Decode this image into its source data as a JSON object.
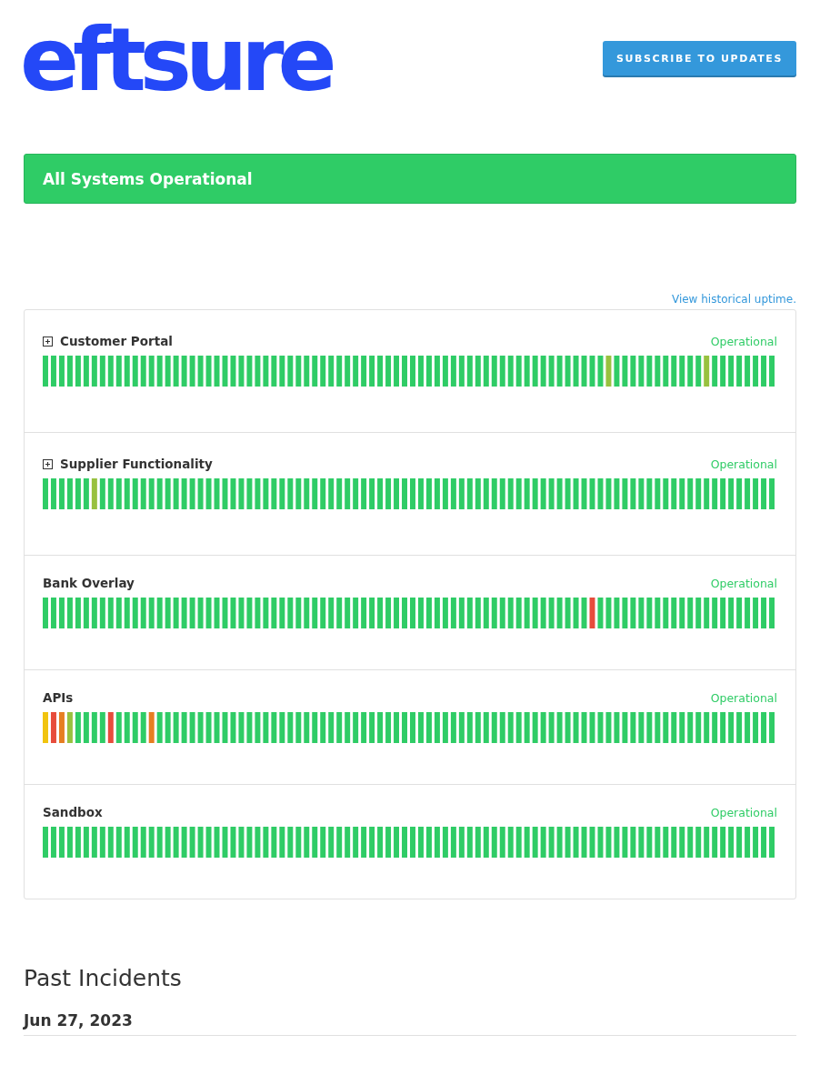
{
  "header": {
    "logo": "eftsure",
    "subscribe_button": "SUBSCRIBE TO UPDATES"
  },
  "status_banner": {
    "text": "All Systems Operational"
  },
  "uptime_link": "View historical uptime.",
  "components": [
    {
      "name": "Customer Portal",
      "expandable": true,
      "status": "Operational",
      "bars": [
        {
          "color": "#2fcc66"
        },
        {
          "color": "#2fcc66"
        },
        {
          "color": "#2fcc66"
        },
        {
          "color": "#2fcc66"
        },
        {
          "color": "#2fcc66"
        },
        {
          "color": "#2fcc66"
        },
        {
          "color": "#2fcc66"
        },
        {
          "color": "#2fcc66"
        },
        {
          "color": "#2fcc66"
        },
        {
          "color": "#2fcc66"
        },
        {
          "color": "#2fcc66"
        },
        {
          "color": "#2fcc66"
        },
        {
          "color": "#2fcc66"
        },
        {
          "color": "#2fcc66"
        },
        {
          "color": "#2fcc66"
        },
        {
          "color": "#2fcc66"
        },
        {
          "color": "#2fcc66"
        },
        {
          "color": "#2fcc66"
        },
        {
          "color": "#2fcc66"
        },
        {
          "color": "#2fcc66"
        },
        {
          "color": "#2fcc66"
        },
        {
          "color": "#2fcc66"
        },
        {
          "color": "#2fcc66"
        },
        {
          "color": "#2fcc66"
        },
        {
          "color": "#2fcc66"
        },
        {
          "color": "#2fcc66"
        },
        {
          "color": "#2fcc66"
        },
        {
          "color": "#2fcc66"
        },
        {
          "color": "#2fcc66"
        },
        {
          "color": "#2fcc66"
        },
        {
          "color": "#2fcc66"
        },
        {
          "color": "#2fcc66"
        },
        {
          "color": "#2fcc66"
        },
        {
          "color": "#2fcc66"
        },
        {
          "color": "#2fcc66"
        },
        {
          "color": "#2fcc66"
        },
        {
          "color": "#2fcc66"
        },
        {
          "color": "#2fcc66"
        },
        {
          "color": "#2fcc66"
        },
        {
          "color": "#2fcc66"
        },
        {
          "color": "#2fcc66"
        },
        {
          "color": "#2fcc66"
        },
        {
          "color": "#2fcc66"
        },
        {
          "color": "#2fcc66"
        },
        {
          "color": "#2fcc66"
        },
        {
          "color": "#2fcc66"
        },
        {
          "color": "#2fcc66"
        },
        {
          "color": "#2fcc66"
        },
        {
          "color": "#2fcc66"
        },
        {
          "color": "#2fcc66"
        },
        {
          "color": "#2fcc66"
        },
        {
          "color": "#2fcc66"
        },
        {
          "color": "#2fcc66"
        },
        {
          "color": "#2fcc66"
        },
        {
          "color": "#2fcc66"
        },
        {
          "color": "#2fcc66"
        },
        {
          "color": "#2fcc66"
        },
        {
          "color": "#2fcc66"
        },
        {
          "color": "#2fcc66"
        },
        {
          "color": "#2fcc66"
        },
        {
          "color": "#2fcc66"
        },
        {
          "color": "#2fcc66"
        },
        {
          "color": "#2fcc66"
        },
        {
          "color": "#2fcc66"
        },
        {
          "color": "#2fcc66"
        },
        {
          "color": "#2fcc66"
        },
        {
          "color": "#2fcc66"
        },
        {
          "color": "#2fcc66"
        },
        {
          "color": "#2fcc66"
        },
        {
          "color": "#98c13f"
        },
        {
          "color": "#2fcc66"
        },
        {
          "color": "#2fcc66"
        },
        {
          "color": "#2fcc66"
        },
        {
          "color": "#2fcc66"
        },
        {
          "color": "#2fcc66"
        },
        {
          "color": "#2fcc66"
        },
        {
          "color": "#2fcc66"
        },
        {
          "color": "#2fcc66"
        },
        {
          "color": "#2fcc66"
        },
        {
          "color": "#2fcc66"
        },
        {
          "color": "#2fcc66"
        },
        {
          "color": "#98c13f"
        },
        {
          "color": "#2fcc66"
        },
        {
          "color": "#2fcc66"
        },
        {
          "color": "#2fcc66"
        },
        {
          "color": "#2fcc66"
        },
        {
          "color": "#2fcc66"
        },
        {
          "color": "#2fcc66"
        },
        {
          "color": "#2fcc66"
        },
        {
          "color": "#2fcc66"
        }
      ]
    },
    {
      "name": "Supplier Functionality",
      "expandable": true,
      "status": "Operational",
      "bars": [
        {
          "color": "#2fcc66"
        },
        {
          "color": "#2fcc66"
        },
        {
          "color": "#2fcc66"
        },
        {
          "color": "#2fcc66"
        },
        {
          "color": "#2fcc66"
        },
        {
          "color": "#2fcc66"
        },
        {
          "color": "#98c13f"
        },
        {
          "color": "#2fcc66"
        },
        {
          "color": "#2fcc66"
        },
        {
          "color": "#2fcc66"
        },
        {
          "color": "#2fcc66"
        },
        {
          "color": "#2fcc66"
        },
        {
          "color": "#2fcc66"
        },
        {
          "color": "#2fcc66"
        },
        {
          "color": "#2fcc66"
        },
        {
          "color": "#2fcc66"
        },
        {
          "color": "#2fcc66"
        },
        {
          "color": "#2fcc66"
        },
        {
          "color": "#2fcc66"
        },
        {
          "color": "#2fcc66"
        },
        {
          "color": "#2fcc66"
        },
        {
          "color": "#2fcc66"
        },
        {
          "color": "#2fcc66"
        },
        {
          "color": "#2fcc66"
        },
        {
          "color": "#2fcc66"
        },
        {
          "color": "#2fcc66"
        },
        {
          "color": "#2fcc66"
        },
        {
          "color": "#2fcc66"
        },
        {
          "color": "#2fcc66"
        },
        {
          "color": "#2fcc66"
        },
        {
          "color": "#2fcc66"
        },
        {
          "color": "#2fcc66"
        },
        {
          "color": "#2fcc66"
        },
        {
          "color": "#2fcc66"
        },
        {
          "color": "#2fcc66"
        },
        {
          "color": "#2fcc66"
        },
        {
          "color": "#2fcc66"
        },
        {
          "color": "#2fcc66"
        },
        {
          "color": "#2fcc66"
        },
        {
          "color": "#2fcc66"
        },
        {
          "color": "#2fcc66"
        },
        {
          "color": "#2fcc66"
        },
        {
          "color": "#2fcc66"
        },
        {
          "color": "#2fcc66"
        },
        {
          "color": "#2fcc66"
        },
        {
          "color": "#2fcc66"
        },
        {
          "color": "#2fcc66"
        },
        {
          "color": "#2fcc66"
        },
        {
          "color": "#2fcc66"
        },
        {
          "color": "#2fcc66"
        },
        {
          "color": "#2fcc66"
        },
        {
          "color": "#2fcc66"
        },
        {
          "color": "#2fcc66"
        },
        {
          "color": "#2fcc66"
        },
        {
          "color": "#2fcc66"
        },
        {
          "color": "#2fcc66"
        },
        {
          "color": "#2fcc66"
        },
        {
          "color": "#2fcc66"
        },
        {
          "color": "#2fcc66"
        },
        {
          "color": "#2fcc66"
        },
        {
          "color": "#2fcc66"
        },
        {
          "color": "#2fcc66"
        },
        {
          "color": "#2fcc66"
        },
        {
          "color": "#2fcc66"
        },
        {
          "color": "#2fcc66"
        },
        {
          "color": "#2fcc66"
        },
        {
          "color": "#2fcc66"
        },
        {
          "color": "#2fcc66"
        },
        {
          "color": "#2fcc66"
        },
        {
          "color": "#2fcc66"
        },
        {
          "color": "#2fcc66"
        },
        {
          "color": "#2fcc66"
        },
        {
          "color": "#2fcc66"
        },
        {
          "color": "#2fcc66"
        },
        {
          "color": "#2fcc66"
        },
        {
          "color": "#2fcc66"
        },
        {
          "color": "#2fcc66"
        },
        {
          "color": "#2fcc66"
        },
        {
          "color": "#2fcc66"
        },
        {
          "color": "#2fcc66"
        },
        {
          "color": "#2fcc66"
        },
        {
          "color": "#2fcc66"
        },
        {
          "color": "#2fcc66"
        },
        {
          "color": "#2fcc66"
        },
        {
          "color": "#2fcc66"
        },
        {
          "color": "#2fcc66"
        },
        {
          "color": "#2fcc66"
        },
        {
          "color": "#2fcc66"
        },
        {
          "color": "#2fcc66"
        },
        {
          "color": "#2fcc66"
        }
      ]
    },
    {
      "name": "Bank Overlay",
      "expandable": false,
      "status": "Operational",
      "bars": [
        {
          "color": "#2fcc66"
        },
        {
          "color": "#2fcc66"
        },
        {
          "color": "#2fcc66"
        },
        {
          "color": "#2fcc66"
        },
        {
          "color": "#2fcc66"
        },
        {
          "color": "#2fcc66"
        },
        {
          "color": "#2fcc66"
        },
        {
          "color": "#2fcc66"
        },
        {
          "color": "#2fcc66"
        },
        {
          "color": "#2fcc66"
        },
        {
          "color": "#2fcc66"
        },
        {
          "color": "#2fcc66"
        },
        {
          "color": "#2fcc66"
        },
        {
          "color": "#2fcc66"
        },
        {
          "color": "#2fcc66"
        },
        {
          "color": "#2fcc66"
        },
        {
          "color": "#2fcc66"
        },
        {
          "color": "#2fcc66"
        },
        {
          "color": "#2fcc66"
        },
        {
          "color": "#2fcc66"
        },
        {
          "color": "#2fcc66"
        },
        {
          "color": "#2fcc66"
        },
        {
          "color": "#2fcc66"
        },
        {
          "color": "#2fcc66"
        },
        {
          "color": "#2fcc66"
        },
        {
          "color": "#2fcc66"
        },
        {
          "color": "#2fcc66"
        },
        {
          "color": "#2fcc66"
        },
        {
          "color": "#2fcc66"
        },
        {
          "color": "#2fcc66"
        },
        {
          "color": "#2fcc66"
        },
        {
          "color": "#2fcc66"
        },
        {
          "color": "#2fcc66"
        },
        {
          "color": "#2fcc66"
        },
        {
          "color": "#2fcc66"
        },
        {
          "color": "#2fcc66"
        },
        {
          "color": "#2fcc66"
        },
        {
          "color": "#2fcc66"
        },
        {
          "color": "#2fcc66"
        },
        {
          "color": "#2fcc66"
        },
        {
          "color": "#2fcc66"
        },
        {
          "color": "#2fcc66"
        },
        {
          "color": "#2fcc66"
        },
        {
          "color": "#2fcc66"
        },
        {
          "color": "#2fcc66"
        },
        {
          "color": "#2fcc66"
        },
        {
          "color": "#2fcc66"
        },
        {
          "color": "#2fcc66"
        },
        {
          "color": "#2fcc66"
        },
        {
          "color": "#2fcc66"
        },
        {
          "color": "#2fcc66"
        },
        {
          "color": "#2fcc66"
        },
        {
          "color": "#2fcc66"
        },
        {
          "color": "#2fcc66"
        },
        {
          "color": "#2fcc66"
        },
        {
          "color": "#2fcc66"
        },
        {
          "color": "#2fcc66"
        },
        {
          "color": "#2fcc66"
        },
        {
          "color": "#2fcc66"
        },
        {
          "color": "#2fcc66"
        },
        {
          "color": "#2fcc66"
        },
        {
          "color": "#2fcc66"
        },
        {
          "color": "#2fcc66"
        },
        {
          "color": "#2fcc66"
        },
        {
          "color": "#2fcc66"
        },
        {
          "color": "#2fcc66"
        },
        {
          "color": "#2fcc66"
        },
        {
          "color": "#e74c3c"
        },
        {
          "color": "#2fcc66"
        },
        {
          "color": "#2fcc66"
        },
        {
          "color": "#2fcc66"
        },
        {
          "color": "#2fcc66"
        },
        {
          "color": "#2fcc66"
        },
        {
          "color": "#2fcc66"
        },
        {
          "color": "#2fcc66"
        },
        {
          "color": "#2fcc66"
        },
        {
          "color": "#2fcc66"
        },
        {
          "color": "#2fcc66"
        },
        {
          "color": "#2fcc66"
        },
        {
          "color": "#2fcc66"
        },
        {
          "color": "#2fcc66"
        },
        {
          "color": "#2fcc66"
        },
        {
          "color": "#2fcc66"
        },
        {
          "color": "#2fcc66"
        },
        {
          "color": "#2fcc66"
        },
        {
          "color": "#2fcc66"
        },
        {
          "color": "#2fcc66"
        },
        {
          "color": "#2fcc66"
        },
        {
          "color": "#2fcc66"
        },
        {
          "color": "#2fcc66"
        }
      ]
    },
    {
      "name": "APIs",
      "expandable": false,
      "status": "Operational",
      "bars": [
        {
          "color": "#f1c40f"
        },
        {
          "color": "#e74c3c"
        },
        {
          "color": "#e67e22"
        },
        {
          "color": "#98c13f"
        },
        {
          "color": "#2fcc66"
        },
        {
          "color": "#2fcc66"
        },
        {
          "color": "#2fcc66"
        },
        {
          "color": "#2fcc66"
        },
        {
          "color": "#e74c3c"
        },
        {
          "color": "#2fcc66"
        },
        {
          "color": "#2fcc66"
        },
        {
          "color": "#2fcc66"
        },
        {
          "color": "#2fcc66"
        },
        {
          "color": "#e67e22"
        },
        {
          "color": "#2fcc66"
        },
        {
          "color": "#2fcc66"
        },
        {
          "color": "#2fcc66"
        },
        {
          "color": "#2fcc66"
        },
        {
          "color": "#2fcc66"
        },
        {
          "color": "#2fcc66"
        },
        {
          "color": "#2fcc66"
        },
        {
          "color": "#2fcc66"
        },
        {
          "color": "#2fcc66"
        },
        {
          "color": "#2fcc66"
        },
        {
          "color": "#2fcc66"
        },
        {
          "color": "#2fcc66"
        },
        {
          "color": "#2fcc66"
        },
        {
          "color": "#2fcc66"
        },
        {
          "color": "#2fcc66"
        },
        {
          "color": "#2fcc66"
        },
        {
          "color": "#2fcc66"
        },
        {
          "color": "#2fcc66"
        },
        {
          "color": "#2fcc66"
        },
        {
          "color": "#2fcc66"
        },
        {
          "color": "#2fcc66"
        },
        {
          "color": "#2fcc66"
        },
        {
          "color": "#2fcc66"
        },
        {
          "color": "#2fcc66"
        },
        {
          "color": "#2fcc66"
        },
        {
          "color": "#2fcc66"
        },
        {
          "color": "#2fcc66"
        },
        {
          "color": "#2fcc66"
        },
        {
          "color": "#2fcc66"
        },
        {
          "color": "#2fcc66"
        },
        {
          "color": "#2fcc66"
        },
        {
          "color": "#2fcc66"
        },
        {
          "color": "#2fcc66"
        },
        {
          "color": "#2fcc66"
        },
        {
          "color": "#2fcc66"
        },
        {
          "color": "#2fcc66"
        },
        {
          "color": "#2fcc66"
        },
        {
          "color": "#2fcc66"
        },
        {
          "color": "#2fcc66"
        },
        {
          "color": "#2fcc66"
        },
        {
          "color": "#2fcc66"
        },
        {
          "color": "#2fcc66"
        },
        {
          "color": "#2fcc66"
        },
        {
          "color": "#2fcc66"
        },
        {
          "color": "#2fcc66"
        },
        {
          "color": "#2fcc66"
        },
        {
          "color": "#2fcc66"
        },
        {
          "color": "#2fcc66"
        },
        {
          "color": "#2fcc66"
        },
        {
          "color": "#2fcc66"
        },
        {
          "color": "#2fcc66"
        },
        {
          "color": "#2fcc66"
        },
        {
          "color": "#2fcc66"
        },
        {
          "color": "#2fcc66"
        },
        {
          "color": "#2fcc66"
        },
        {
          "color": "#2fcc66"
        },
        {
          "color": "#2fcc66"
        },
        {
          "color": "#2fcc66"
        },
        {
          "color": "#2fcc66"
        },
        {
          "color": "#2fcc66"
        },
        {
          "color": "#2fcc66"
        },
        {
          "color": "#2fcc66"
        },
        {
          "color": "#2fcc66"
        },
        {
          "color": "#2fcc66"
        },
        {
          "color": "#2fcc66"
        },
        {
          "color": "#2fcc66"
        },
        {
          "color": "#2fcc66"
        },
        {
          "color": "#2fcc66"
        },
        {
          "color": "#2fcc66"
        },
        {
          "color": "#2fcc66"
        },
        {
          "color": "#2fcc66"
        },
        {
          "color": "#2fcc66"
        },
        {
          "color": "#2fcc66"
        },
        {
          "color": "#2fcc66"
        },
        {
          "color": "#2fcc66"
        },
        {
          "color": "#2fcc66"
        }
      ]
    },
    {
      "name": "Sandbox",
      "expandable": false,
      "status": "Operational",
      "bars": [
        {
          "color": "#2fcc66"
        },
        {
          "color": "#2fcc66"
        },
        {
          "color": "#2fcc66"
        },
        {
          "color": "#2fcc66"
        },
        {
          "color": "#2fcc66"
        },
        {
          "color": "#2fcc66"
        },
        {
          "color": "#2fcc66"
        },
        {
          "color": "#2fcc66"
        },
        {
          "color": "#2fcc66"
        },
        {
          "color": "#2fcc66"
        },
        {
          "color": "#2fcc66"
        },
        {
          "color": "#2fcc66"
        },
        {
          "color": "#2fcc66"
        },
        {
          "color": "#2fcc66"
        },
        {
          "color": "#2fcc66"
        },
        {
          "color": "#2fcc66"
        },
        {
          "color": "#2fcc66"
        },
        {
          "color": "#2fcc66"
        },
        {
          "color": "#2fcc66"
        },
        {
          "color": "#2fcc66"
        },
        {
          "color": "#2fcc66"
        },
        {
          "color": "#2fcc66"
        },
        {
          "color": "#2fcc66"
        },
        {
          "color": "#2fcc66"
        },
        {
          "color": "#2fcc66"
        },
        {
          "color": "#2fcc66"
        },
        {
          "color": "#2fcc66"
        },
        {
          "color": "#2fcc66"
        },
        {
          "color": "#2fcc66"
        },
        {
          "color": "#2fcc66"
        },
        {
          "color": "#2fcc66"
        },
        {
          "color": "#2fcc66"
        },
        {
          "color": "#2fcc66"
        },
        {
          "color": "#2fcc66"
        },
        {
          "color": "#2fcc66"
        },
        {
          "color": "#2fcc66"
        },
        {
          "color": "#2fcc66"
        },
        {
          "color": "#2fcc66"
        },
        {
          "color": "#2fcc66"
        },
        {
          "color": "#2fcc66"
        },
        {
          "color": "#2fcc66"
        },
        {
          "color": "#2fcc66"
        },
        {
          "color": "#2fcc66"
        },
        {
          "color": "#2fcc66"
        },
        {
          "color": "#2fcc66"
        },
        {
          "color": "#2fcc66"
        },
        {
          "color": "#2fcc66"
        },
        {
          "color": "#2fcc66"
        },
        {
          "color": "#2fcc66"
        },
        {
          "color": "#2fcc66"
        },
        {
          "color": "#2fcc66"
        },
        {
          "color": "#2fcc66"
        },
        {
          "color": "#2fcc66"
        },
        {
          "color": "#2fcc66"
        },
        {
          "color": "#2fcc66"
        },
        {
          "color": "#2fcc66"
        },
        {
          "color": "#2fcc66"
        },
        {
          "color": "#2fcc66"
        },
        {
          "color": "#2fcc66"
        },
        {
          "color": "#2fcc66"
        },
        {
          "color": "#2fcc66"
        },
        {
          "color": "#2fcc66"
        },
        {
          "color": "#2fcc66"
        },
        {
          "color": "#2fcc66"
        },
        {
          "color": "#2fcc66"
        },
        {
          "color": "#2fcc66"
        },
        {
          "color": "#2fcc66"
        },
        {
          "color": "#2fcc66"
        },
        {
          "color": "#2fcc66"
        },
        {
          "color": "#2fcc66"
        },
        {
          "color": "#2fcc66"
        },
        {
          "color": "#2fcc66"
        },
        {
          "color": "#2fcc66"
        },
        {
          "color": "#2fcc66"
        },
        {
          "color": "#2fcc66"
        },
        {
          "color": "#2fcc66"
        },
        {
          "color": "#2fcc66"
        },
        {
          "color": "#2fcc66"
        },
        {
          "color": "#2fcc66"
        },
        {
          "color": "#2fcc66"
        },
        {
          "color": "#2fcc66"
        },
        {
          "color": "#2fcc66"
        },
        {
          "color": "#2fcc66"
        },
        {
          "color": "#2fcc66"
        },
        {
          "color": "#2fcc66"
        },
        {
          "color": "#2fcc66"
        },
        {
          "color": "#2fcc66"
        },
        {
          "color": "#2fcc66"
        },
        {
          "color": "#2fcc66"
        },
        {
          "color": "#2fcc66"
        }
      ]
    }
  ],
  "past_incidents": {
    "title": "Past Incidents",
    "dates": [
      "Jun 27, 2023"
    ]
  }
}
